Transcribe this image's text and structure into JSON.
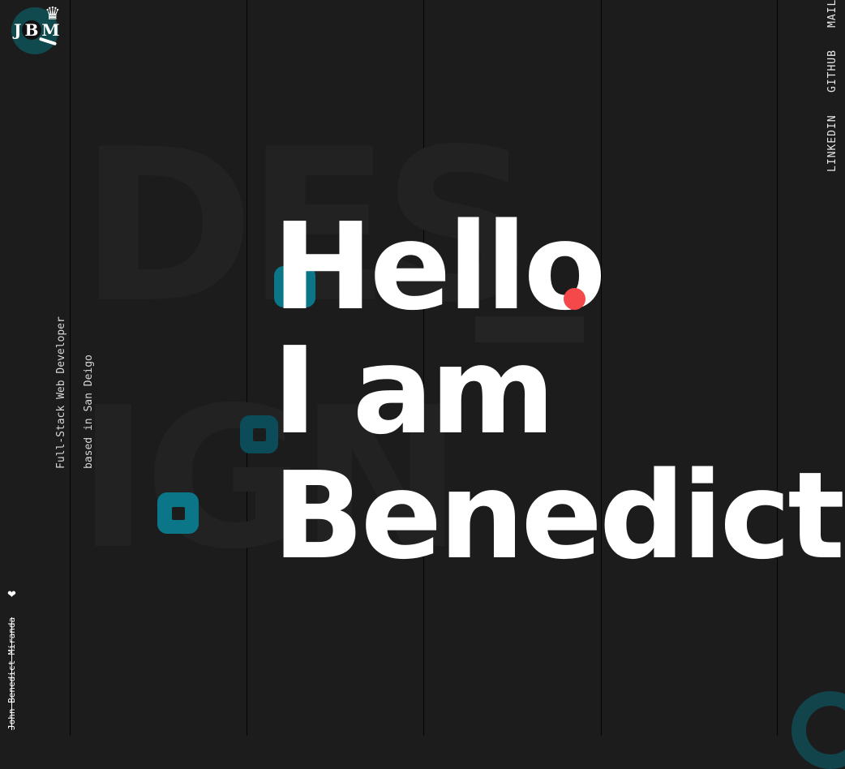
{
  "logo": {
    "text_j": "J",
    "text_b": "B",
    "text_m": "M",
    "crown": "♛"
  },
  "background": {
    "line1": "DES",
    "line2": "IGN"
  },
  "hero": {
    "line1": "Hello",
    "line2": "I am",
    "line3": "Benedict"
  },
  "sidebar": {
    "role": "Full-Stack Web Developer",
    "location": "based in San Deigo"
  },
  "nav": {
    "mail": "MAIL",
    "github": "GITHUB",
    "linkedin": "LINKEDIN"
  },
  "footer": {
    "credit": "John Benedict Miranda",
    "heart": "❤"
  },
  "colors": {
    "background": "#1c1c1c",
    "accent_teal": "#0b7688",
    "accent_red": "#f5484a",
    "text": "#ffffff"
  },
  "icons": {
    "logo": "jbm-logo-icon",
    "heart": "heart-icon"
  }
}
